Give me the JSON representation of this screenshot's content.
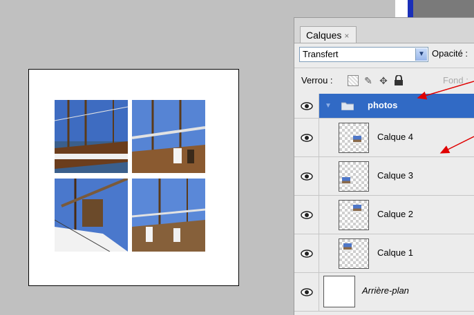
{
  "panel": {
    "tab_label": "Calques",
    "tab_close": "×",
    "blend_mode": "Transfert",
    "opacity_label": "Opacité :",
    "lock_label": "Verrou :",
    "fill_label": "Fond :",
    "layers": [
      {
        "name": "photos",
        "type": "group",
        "selected": true
      },
      {
        "name": "Calque 4",
        "type": "layer"
      },
      {
        "name": "Calque 3",
        "type": "layer"
      },
      {
        "name": "Calque 2",
        "type": "layer"
      },
      {
        "name": "Calque 1",
        "type": "layer"
      },
      {
        "name": "Arrière-plan",
        "type": "background"
      }
    ]
  },
  "icons": {
    "visibility": "eye-icon",
    "group": "folder-icon",
    "expand": "triangle-down-icon",
    "lock_transparency": "checkerboard-icon",
    "lock_pixels": "brush-icon",
    "lock_position": "move-icon",
    "lock_all": "padlock-icon"
  },
  "colors": {
    "selection": "#316ac5",
    "annotation_arrow": "#e00000",
    "workspace": "#c0c0c0"
  }
}
